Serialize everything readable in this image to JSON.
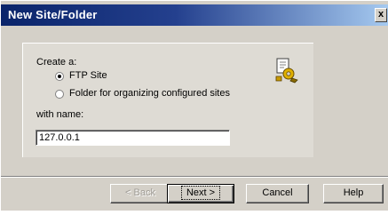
{
  "window": {
    "title": "New Site/Folder",
    "close_label": "x"
  },
  "form": {
    "create_label": "Create a:",
    "option_ftp_site": "FTP Site",
    "option_folder": "Folder for organizing configured sites",
    "selected_option": "FTP Site",
    "name_label": "with name:",
    "name_value": "127.0.0.1"
  },
  "buttons": {
    "back": "< Back",
    "next": "Next >",
    "cancel": "Cancel",
    "help": "Help"
  },
  "icons": {
    "wizard": "ftp-site-wizard-icon"
  }
}
